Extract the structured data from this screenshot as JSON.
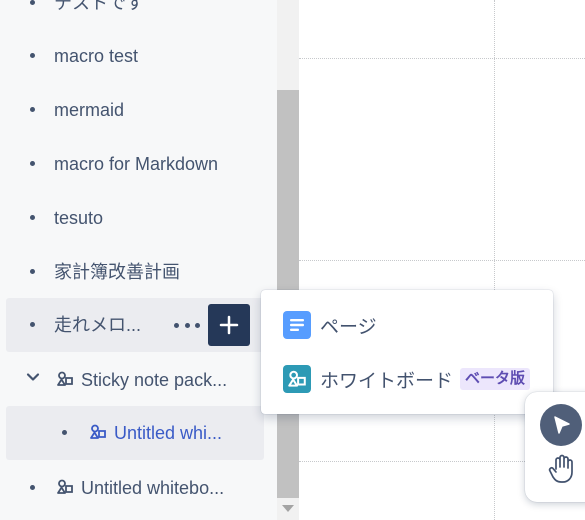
{
  "sidebar": {
    "items": [
      {
        "label": "テストです",
        "type": "page"
      },
      {
        "label": "macro test",
        "type": "page"
      },
      {
        "label": "mermaid",
        "type": "page"
      },
      {
        "label": "macro for Markdown",
        "type": "page"
      },
      {
        "label": "tesuto",
        "type": "page"
      },
      {
        "label": "家計簿改善計画",
        "type": "page"
      },
      {
        "label": "走れメロ...",
        "type": "page",
        "state": "hover"
      },
      {
        "label": "Sticky note pack...",
        "type": "whiteboard",
        "expanded": true
      },
      {
        "label": "Untitled whi...",
        "type": "whiteboard",
        "state": "selected",
        "nested": true
      },
      {
        "label": "Untitled whitebo...",
        "type": "whiteboard"
      }
    ],
    "more_icon": "more-horizontal-icon",
    "add_icon": "plus-icon"
  },
  "create_menu": {
    "items": [
      {
        "label": "ページ",
        "icon": "page-icon",
        "icon_color": "#579dff"
      },
      {
        "label": "ホワイトボード",
        "icon": "whiteboard-icon",
        "icon_color": "#2d9ab5",
        "badge": "ベータ版"
      }
    ]
  },
  "toolbar": {
    "tools": [
      {
        "name": "select",
        "icon": "pointer-icon",
        "active": true
      },
      {
        "name": "pan",
        "icon": "hand-icon",
        "active": false
      }
    ]
  },
  "colors": {
    "sidebar_bg": "#f7f8f9",
    "selected_text": "#3a5bc7",
    "add_button_bg": "#253858",
    "badge_bg": "#ece6fc",
    "badge_text": "#5e4db2"
  }
}
